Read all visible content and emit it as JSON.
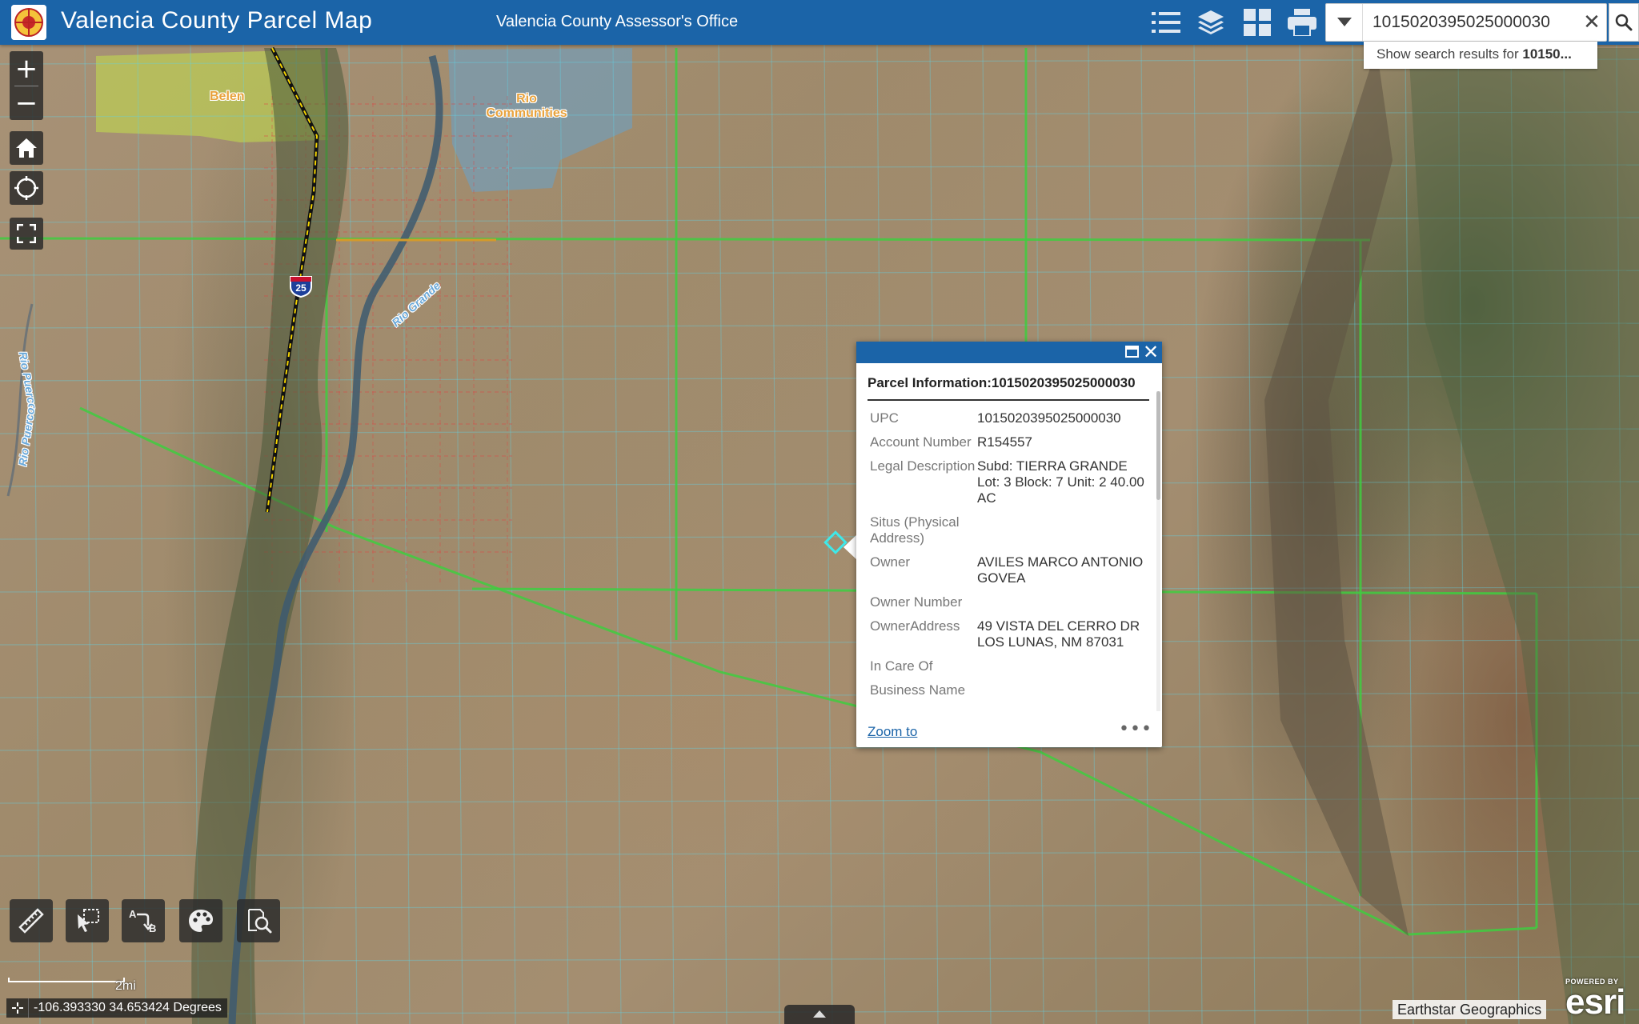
{
  "header": {
    "app_title": "Valencia County Parcel Map",
    "subtitle": "Valencia County Assessor's Office",
    "icons": [
      "legend-list-icon",
      "layers-icon",
      "basemap-gallery-icon",
      "print-icon"
    ]
  },
  "search": {
    "value": "1015020395025000030",
    "suggestion_prefix": "Show search results for ",
    "suggestion_term": "10150..."
  },
  "map": {
    "place_labels": {
      "belen": "Belen",
      "rio_communities": "Rio Communities",
      "interstate": "25",
      "river": "Rio Grande",
      "river_west_a": "Rio Puerco",
      "river_west_b": "Rio Puerco"
    }
  },
  "popup": {
    "title": "Parcel Information:1015020395025000030",
    "fields": [
      {
        "label": "UPC",
        "value": "1015020395025000030"
      },
      {
        "label": "Account Number",
        "value": "R154557"
      },
      {
        "label": "Legal Description",
        "value": "Subd: TIERRA GRANDE Lot: 3 Block: 7 Unit: 2 40.00 AC"
      },
      {
        "label": "Situs (Physical Address)",
        "value": ""
      },
      {
        "label": "Owner",
        "value": "AVILES MARCO ANTONIO GOVEA"
      },
      {
        "label": "Owner Number",
        "value": ""
      },
      {
        "label": "OwnerAddress",
        "value": "49 VISTA DEL CERRO DR LOS LUNAS, NM 87031"
      },
      {
        "label": "In Care Of",
        "value": ""
      },
      {
        "label": "Business Name",
        "value": ""
      }
    ],
    "zoom_to": "Zoom to",
    "more": "•••"
  },
  "controls": {
    "zoom_in": "+",
    "zoom_out": "−"
  },
  "scalebar": {
    "label": "2mi"
  },
  "coordinates": {
    "text": "-106.393330 34.653424 Degrees"
  },
  "attribution": {
    "text": "Earthstar Geographics"
  },
  "esri": {
    "powered_by": "POWERED BY",
    "word": "esri"
  },
  "colors": {
    "header_blue": "#1b64a8",
    "parcel_grid": "#5fd3e8",
    "section_lines": "#3fcc3f",
    "city_limits_belen": "#c3e04a",
    "city_limits_rio": "#5aa7e0"
  }
}
